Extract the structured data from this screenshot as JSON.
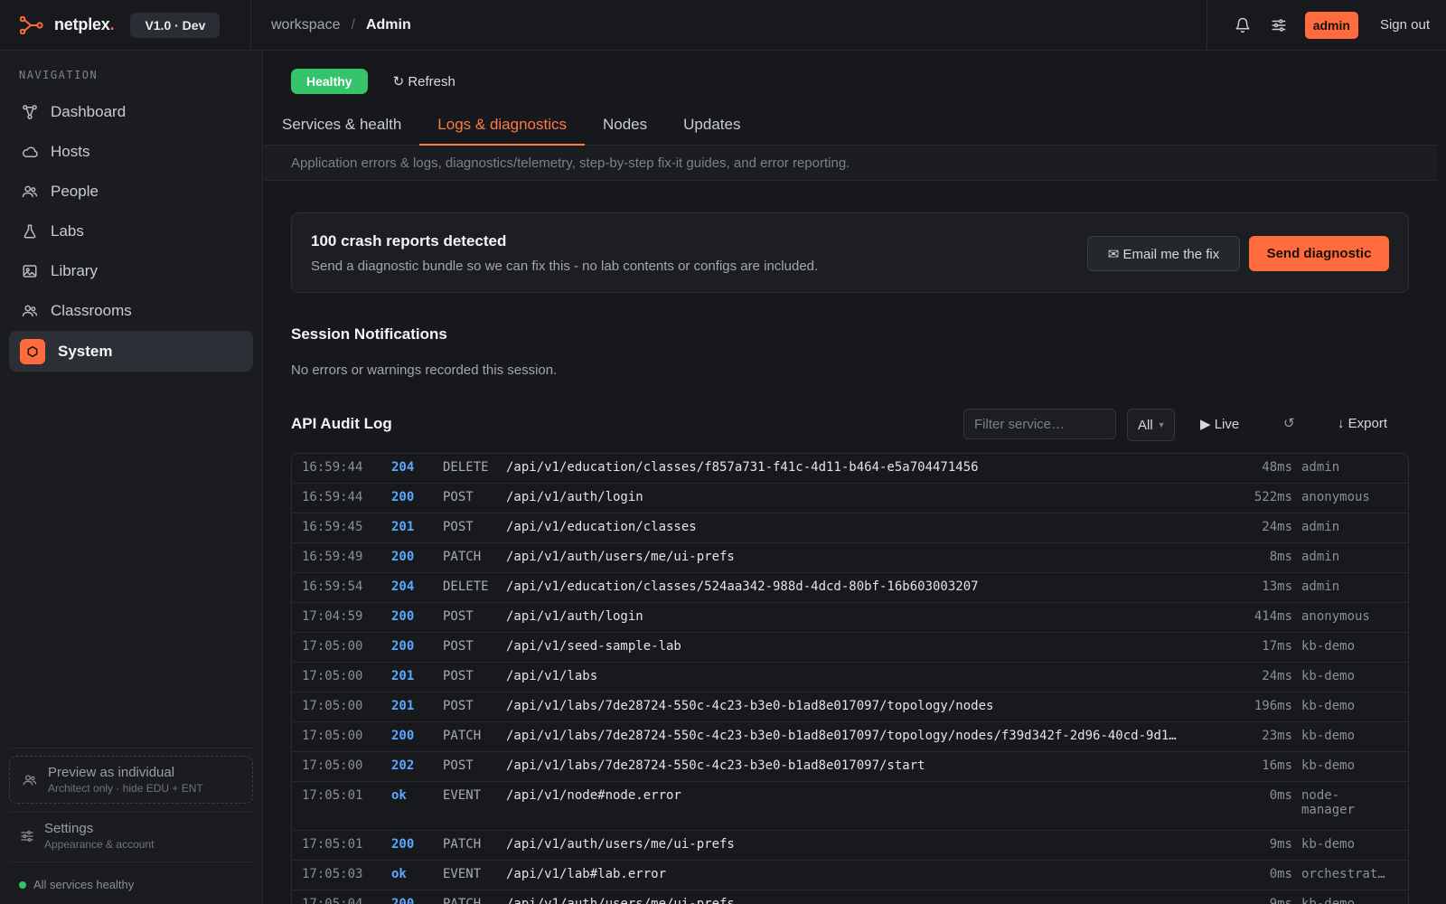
{
  "brand": {
    "name": "netplex",
    "dot": ".",
    "version": "V1.0 · Dev"
  },
  "breadcrumb": {
    "workspace": "workspace",
    "separator": "/",
    "current": "Admin"
  },
  "header": {
    "admin_label": "admin",
    "signout_label": "Sign out"
  },
  "sidebar": {
    "heading": "NAVIGATION",
    "items": [
      {
        "label": "Dashboard",
        "icon": "topology-icon"
      },
      {
        "label": "Hosts",
        "icon": "cloud-icon"
      },
      {
        "label": "People",
        "icon": "people-icon"
      },
      {
        "label": "Labs",
        "icon": "flask-icon"
      },
      {
        "label": "Library",
        "icon": "image-icon"
      },
      {
        "label": "Classrooms",
        "icon": "classroom-icon"
      },
      {
        "label": "System",
        "icon": "shield-icon",
        "active": true
      }
    ],
    "preview": {
      "title": "Preview as individual",
      "subtitle": "Architect only · hide EDU + ENT"
    },
    "settings": {
      "title": "Settings",
      "subtitle": "Appearance & account"
    },
    "health": "All services healthy"
  },
  "main": {
    "status": "Healthy",
    "refresh_label": "↻ Refresh",
    "tabs": [
      "Services & health",
      "Logs & diagnostics",
      "Nodes",
      "Updates"
    ],
    "active_tab": 1,
    "subtitle": "Application errors & logs, diagnostics/telemetry, step-by-step fix-it guides, and error reporting.",
    "crash": {
      "title": "100 crash reports detected",
      "subtitle": "Send a diagnostic bundle so we can fix this - no lab contents or configs are included.",
      "email_label": "✉ Email me the fix",
      "send_label": "Send diagnostic"
    },
    "session": {
      "title": "Session Notifications",
      "empty": "No errors or warnings recorded this session."
    },
    "audit": {
      "title": "API Audit Log",
      "filter_placeholder": "Filter service…",
      "select_value": "All",
      "live_label": "▶ Live",
      "reload_label": "↺",
      "export_label": "↓ Export",
      "rows": [
        {
          "time": "16:59:44",
          "code": "204",
          "method": "DELETE",
          "path": "/api/v1/education/classes/f857a731-f41c-4d11-b464-e5a704471456",
          "dur": "48ms",
          "user": "admin"
        },
        {
          "time": "16:59:44",
          "code": "200",
          "method": "POST",
          "path": "/api/v1/auth/login",
          "dur": "522ms",
          "user": "anonymous"
        },
        {
          "time": "16:59:45",
          "code": "201",
          "method": "POST",
          "path": "/api/v1/education/classes",
          "dur": "24ms",
          "user": "admin"
        },
        {
          "time": "16:59:49",
          "code": "200",
          "method": "PATCH",
          "path": "/api/v1/auth/users/me/ui-prefs",
          "dur": "8ms",
          "user": "admin"
        },
        {
          "time": "16:59:54",
          "code": "204",
          "method": "DELETE",
          "path": "/api/v1/education/classes/524aa342-988d-4dcd-80bf-16b603003207",
          "dur": "13ms",
          "user": "admin"
        },
        {
          "time": "17:04:59",
          "code": "200",
          "method": "POST",
          "path": "/api/v1/auth/login",
          "dur": "414ms",
          "user": "anonymous"
        },
        {
          "time": "17:05:00",
          "code": "200",
          "method": "POST",
          "path": "/api/v1/seed-sample-lab",
          "dur": "17ms",
          "user": "kb-demo"
        },
        {
          "time": "17:05:00",
          "code": "201",
          "method": "POST",
          "path": "/api/v1/labs",
          "dur": "24ms",
          "user": "kb-demo"
        },
        {
          "time": "17:05:00",
          "code": "201",
          "method": "POST",
          "path": "/api/v1/labs/7de28724-550c-4c23-b3e0-b1ad8e017097/topology/nodes",
          "dur": "196ms",
          "user": "kb-demo"
        },
        {
          "time": "17:05:00",
          "code": "200",
          "method": "PATCH",
          "path": "/api/v1/labs/7de28724-550c-4c23-b3e0-b1ad8e017097/topology/nodes/f39d342f-2d96-40cd-9d1…",
          "dur": "23ms",
          "user": "kb-demo"
        },
        {
          "time": "17:05:00",
          "code": "202",
          "method": "POST",
          "path": "/api/v1/labs/7de28724-550c-4c23-b3e0-b1ad8e017097/start",
          "dur": "16ms",
          "user": "kb-demo"
        },
        {
          "time": "17:05:01",
          "code": "ok",
          "method": "EVENT",
          "path": "/api/v1/node#node.error",
          "dur": "0ms",
          "user": "node-manager"
        },
        {
          "time": "17:05:01",
          "code": "200",
          "method": "PATCH",
          "path": "/api/v1/auth/users/me/ui-prefs",
          "dur": "9ms",
          "user": "kb-demo"
        },
        {
          "time": "17:05:03",
          "code": "ok",
          "method": "EVENT",
          "path": "/api/v1/lab#lab.error",
          "dur": "0ms",
          "user": "orchestrat…"
        },
        {
          "time": "17:05:04",
          "code": "200",
          "method": "PATCH",
          "path": "/api/v1/auth/users/me/ui-prefs",
          "dur": "9ms",
          "user": "kb-demo"
        }
      ]
    }
  },
  "colors": {
    "accent": "#ff6b3d",
    "healthy": "#35c36b",
    "status_code": "#5aa9ff"
  }
}
